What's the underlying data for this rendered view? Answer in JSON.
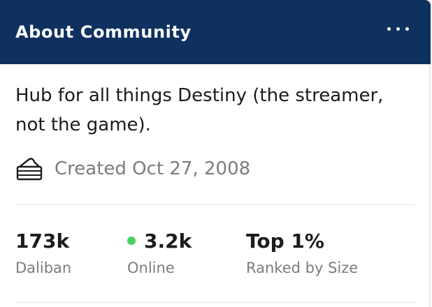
{
  "header": {
    "title": "About Community",
    "more_icon": "more-horizontal-icon",
    "background_color": "#0e3160"
  },
  "description": "Hub for all things Destiny (the streamer, not the game).",
  "created": {
    "icon": "cake-icon",
    "text": "Created Oct 27, 2008"
  },
  "stats": [
    {
      "value": "173k",
      "label": "Daliban"
    },
    {
      "value": "3.2k",
      "label": "Online",
      "status_color": "#46d160"
    },
    {
      "value": "Top 1%",
      "label": "Ranked by Size"
    }
  ]
}
